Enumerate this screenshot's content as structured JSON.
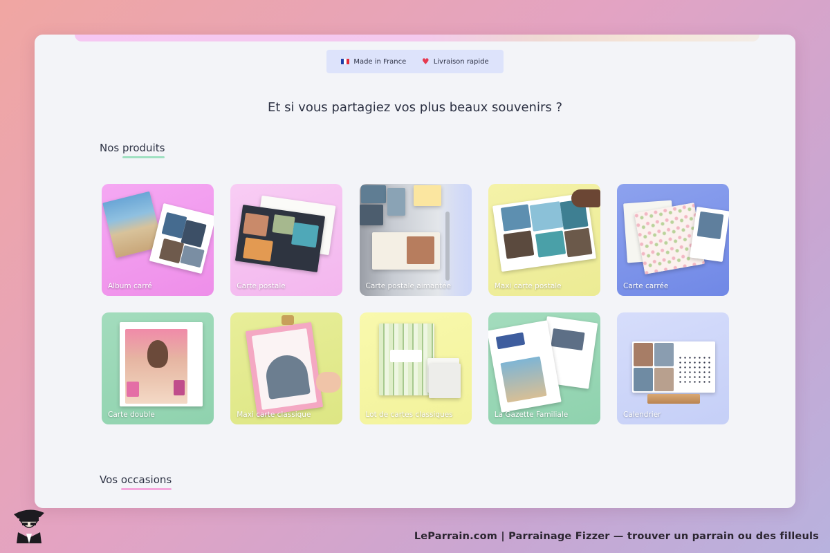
{
  "badges": [
    {
      "label": "Made in France",
      "icon": "france-flag-icon"
    },
    {
      "label": "Livraison rapide",
      "icon": "heart-icon"
    }
  ],
  "headline": "Et si vous partagiez vos plus beaux souvenirs ?",
  "sections": {
    "products": {
      "prefix": "Nos",
      "highlight": "produits"
    },
    "occasions": {
      "prefix": "Vos",
      "highlight": "occasions"
    }
  },
  "products": [
    {
      "label": "Album carré",
      "bg": "#f39bf0"
    },
    {
      "label": "Carte postale",
      "bg": "#f6c2f2"
    },
    {
      "label": "Carte postale aimantée",
      "bg": "#cdd6f8"
    },
    {
      "label": "Maxi carte postale",
      "bg": "#f1ef9f"
    },
    {
      "label": "Carte carrée",
      "bg": "#7e95ea"
    },
    {
      "label": "Carte double",
      "bg": "#9ed9b7"
    },
    {
      "label": "Maxi carte classique",
      "bg": "#e3eb93"
    },
    {
      "label": "Lot de cartes classiques",
      "bg": "#f6f6a5"
    },
    {
      "label": "La Gazette Familiale",
      "bg": "#9ed9b7"
    },
    {
      "label": "Calendrier",
      "bg": "#cdd6f8"
    }
  ],
  "footer": {
    "credit": "LeParrain.com | Parrainage Fizzer — trouver un parrain ou des filleuls"
  },
  "colors": {
    "accent_produits": "#9fe0c1",
    "accent_occasions": "#f4a7dc",
    "heart": "#e63950"
  }
}
